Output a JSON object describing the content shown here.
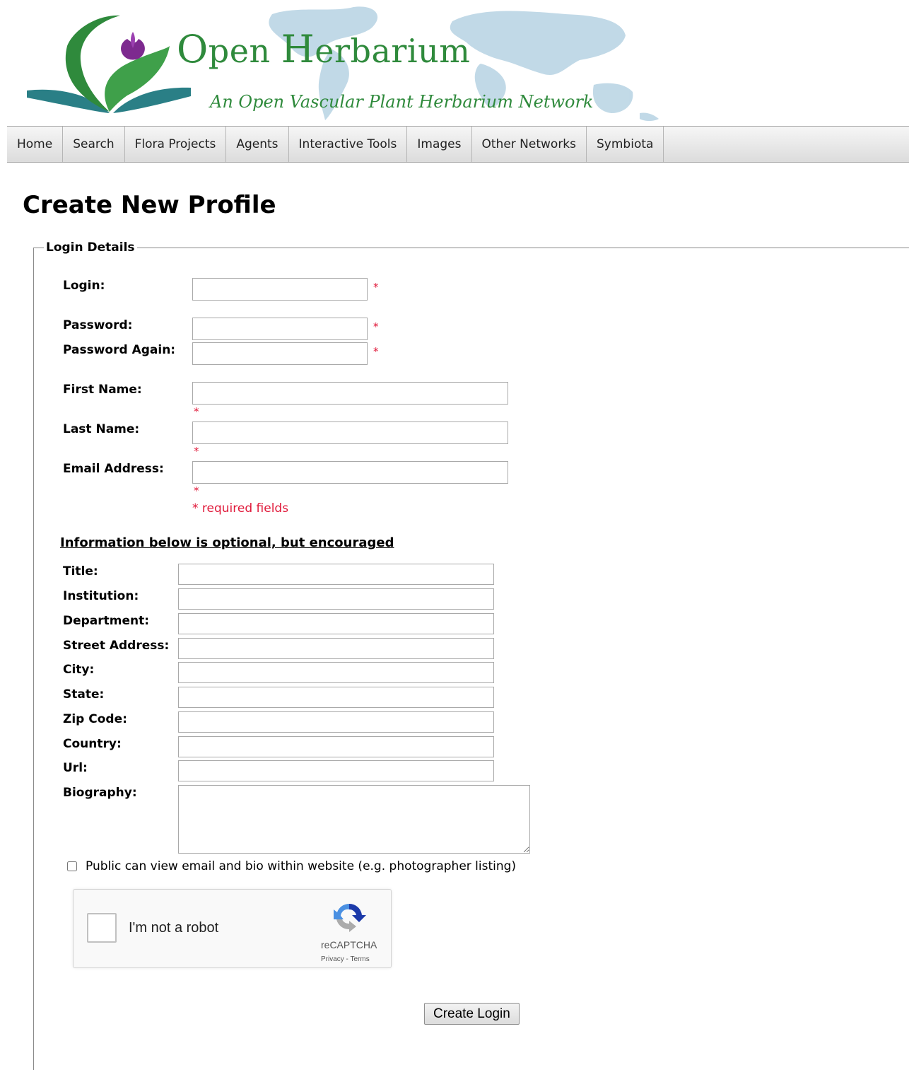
{
  "site": {
    "title_first_letter": "O",
    "title_first_rest": "pen ",
    "title_second_letter": "H",
    "title_second_rest": "erbarium",
    "subtitle": "An Open Vascular Plant Herbarium Network"
  },
  "nav": {
    "items": [
      "Home",
      "Search",
      "Flora Projects",
      "Agents",
      "Interactive Tools",
      "Images",
      "Other Networks",
      "Symbiota"
    ]
  },
  "page": {
    "title": "Create New Profile"
  },
  "form": {
    "legend": "Login Details",
    "required_marker": "*",
    "required_note": "* required fields",
    "required_fields": [
      {
        "label": "Login:",
        "value": ""
      },
      {
        "label": "Password:",
        "value": ""
      },
      {
        "label": "Password Again:",
        "value": ""
      },
      {
        "label": "First Name:",
        "value": ""
      },
      {
        "label": "Last Name:",
        "value": ""
      },
      {
        "label": "Email Address:",
        "value": ""
      }
    ],
    "optional_heading": "Information below is optional, but encouraged",
    "optional_fields": [
      {
        "label": "Title:",
        "value": ""
      },
      {
        "label": "Institution:",
        "value": ""
      },
      {
        "label": "Department:",
        "value": ""
      },
      {
        "label": "Street Address:",
        "value": ""
      },
      {
        "label": "City:",
        "value": ""
      },
      {
        "label": "State:",
        "value": ""
      },
      {
        "label": "Zip Code:",
        "value": ""
      },
      {
        "label": "Country:",
        "value": ""
      },
      {
        "label": "Url:",
        "value": ""
      }
    ],
    "biography": {
      "label": "Biography:",
      "value": ""
    },
    "public_checkbox": {
      "label": "Public can view email and bio within website (e.g. photographer listing)",
      "checked": false
    },
    "captcha": {
      "label": "I'm not a robot",
      "brand": "reCAPTCHA",
      "links": "Privacy - Terms"
    },
    "submit_label": "Create Login"
  },
  "colors": {
    "brand_green": "#2f8a3c",
    "required_red": "#e0193a",
    "map_blue": "#b7d3e3"
  }
}
